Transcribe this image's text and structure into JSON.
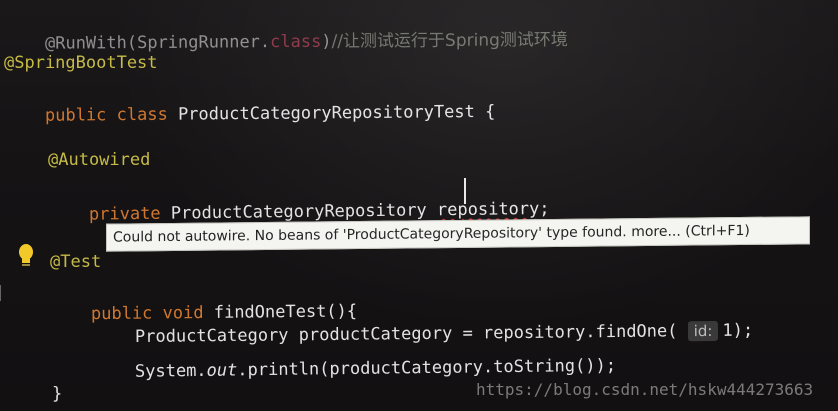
{
  "editor": {
    "line_runwith": {
      "annotation": "@RunWith(SpringRunner.",
      "class_kw": "class",
      "close": ")",
      "comment": "//让测试运行于Spring测试环境"
    },
    "line_springboottest": "@SpringBootTest",
    "line_class_decl": {
      "kw": "public class",
      "name": "ProductCategoryRepositoryTest",
      "brace": "{"
    },
    "line_autowired": "@Autowired",
    "line_field": {
      "kw": "private",
      "type": "ProductCategoryRepository",
      "name": "repository",
      "semicolon": ";"
    },
    "tooltip": {
      "message": "Could not autowire. No beans of 'ProductCategoryRepository' type found.",
      "more": "more...",
      "shortcut": "(Ctrl+F1)"
    },
    "line_test": "@Test",
    "line_method": {
      "kw": "public void",
      "name": "findOneTest",
      "parens": "(){"
    },
    "line_find": {
      "type": "ProductCategory",
      "var": "productCategory",
      "assign": "= repository.findOne(",
      "hint": "id:",
      "arg": "1);"
    },
    "line_print": {
      "system": "System.",
      "out": "out",
      "rest": ".println(productCategory.toString());"
    },
    "line_close": "}"
  },
  "watermark": "https://blog.csdn.net/hskw444273663",
  "icons": [
    "lightbulb-icon",
    "text-cursor-icon",
    "gutter-fold-icon"
  ],
  "colors": {
    "background": "#151314",
    "annotation": "#c6bb46",
    "keyword": "#d0772f",
    "tooltip_bg": "#f4f4f1",
    "error_underline": "#bb3333"
  }
}
